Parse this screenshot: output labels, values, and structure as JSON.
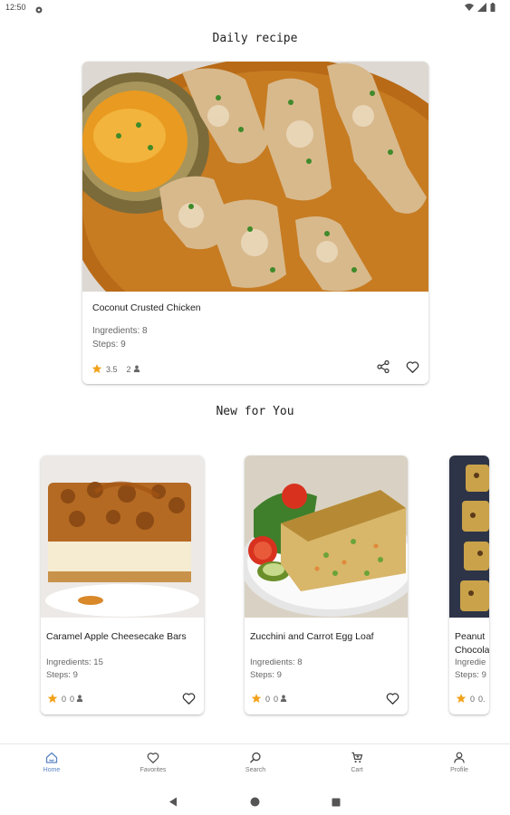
{
  "status_bar": {
    "time": "12:50"
  },
  "daily": {
    "title": "Daily recipe",
    "recipe": {
      "name": "Coconut Crusted Chicken",
      "ingredients": "Ingredients: 8",
      "steps": "Steps: 9",
      "rating": "3.5",
      "count": "2"
    }
  },
  "new_for_you": {
    "title": "New for You",
    "cards": [
      {
        "name": "Caramel Apple Cheesecake Bars",
        "ingredients": "Ingredients: 15",
        "steps": "Steps: 9",
        "rating": "0",
        "count": "0"
      },
      {
        "name": "Zucchini and Carrot Egg Loaf",
        "ingredients": "Ingredients: 8",
        "steps": "Steps: 9",
        "rating": "0",
        "count": "0"
      },
      {
        "name": "Peanut Chocola",
        "ingredients": "Ingredie",
        "steps": "Steps: 9",
        "rating": "0",
        "count": "0."
      }
    ]
  },
  "bottom_nav": [
    {
      "label": "Home",
      "icon": "home-icon",
      "active": true
    },
    {
      "label": "Favorites",
      "icon": "heart-icon"
    },
    {
      "label": "Search",
      "icon": "search-icon"
    },
    {
      "label": "Cart",
      "icon": "cart-icon"
    },
    {
      "label": "Profile",
      "icon": "person-icon"
    }
  ],
  "colors": {
    "accent": "#5b84c4",
    "star": "#f2a21b",
    "text": "#222222",
    "muted": "#666666"
  }
}
